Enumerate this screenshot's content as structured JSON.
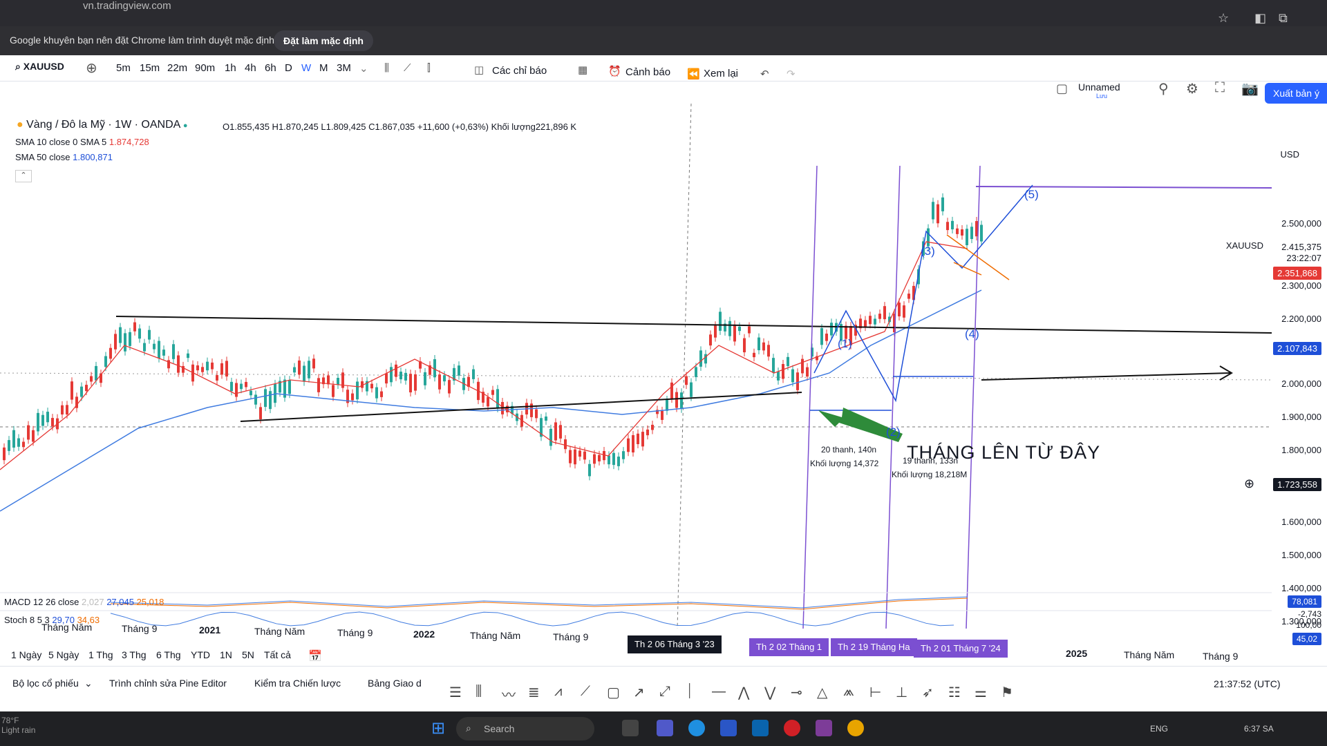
{
  "browser": {
    "url": "vn.tradingview.com",
    "infobar_message": "Google khuyên bạn nên đặt Chrome làm trình duyệt mặc định",
    "infobar_button": "Đặt làm mặc định"
  },
  "toolbar": {
    "symbol": "XAUUSD",
    "intervals": [
      "5m",
      "15m",
      "22m",
      "90m",
      "1h",
      "4h",
      "6h",
      "D",
      "W",
      "M",
      "3M"
    ],
    "active_interval": "W",
    "indicators": "Các chỉ báo",
    "alerts": "Cảnh báo",
    "replay": "Xem lại",
    "layout_name": "Unnamed",
    "layout_saved": "Lưu",
    "export": "Xuất bản ý",
    "currency": "USD"
  },
  "legend": {
    "title": "Vàng / Đô la Mỹ · 1W · OANDA",
    "ohlc": "O1.855,435  H1.870,245  L1.809,425  C1.867,035  +11,600 (+0,63%)  Khối lượng221,896 K",
    "sma1_label": "SMA 10 close 0 SMA 5",
    "sma1_value": "1.874,728",
    "sma2_label": "SMA 50 close",
    "sma2_value": "1.800,871"
  },
  "price_axis": {
    "labels": [
      "2.500,000",
      "2.300,000",
      "2.200,000",
      "2.000,000",
      "1.900,000",
      "1.800,000",
      "1.600,000",
      "1.500,000",
      "1.400,000",
      "1.300,000"
    ],
    "symbol_tag": "XAUUSD",
    "last_price": "2.415,375",
    "countdown": "23:22:07",
    "tag_red": "2.351,868",
    "tag_blue": "2.107,843",
    "crosshair_price": "1.723,558",
    "macd_tag_1": "78,081",
    "macd_tag_2": "-2,743",
    "macd_tag_3": "100,00",
    "stoch_tag": "45,02"
  },
  "annotations": {
    "waves": [
      "(1)",
      "(2)",
      "(3)",
      "(4)",
      "(5)"
    ],
    "box1_line1": "20 thanh, 140n",
    "box1_line2": "Khối lượng 14,372",
    "box2_line1": "19 thanh, 133n",
    "box2_line2": "Khối lượng 18,218M",
    "big_text": "THÁNG LÊN TỪ ĐÂY"
  },
  "indicators": {
    "macd_label": "MACD 12 26 close",
    "macd_v1": "2,027",
    "macd_v2": "27,045",
    "macd_v3": "25,018",
    "stoch_label": "Stoch 8 5 3",
    "stoch_v1": "29,70",
    "stoch_v2": "34,63"
  },
  "time_axis": {
    "labels": [
      "Tháng Năm",
      "Tháng 9",
      "2021",
      "Tháng Năm",
      "Tháng 9",
      "2022",
      "Tháng Năm",
      "Tháng 9",
      "2025",
      "Tháng Năm",
      "Tháng 9"
    ],
    "crosshair_date": "Th 2 06 Tháng 3 '23",
    "range_box_1": "Th 2 02 Tháng 1",
    "range_box_2": "Th 2 19 Tháng Ha",
    "range_box_3": "Th 2 01 Tháng 7 '24"
  },
  "bottom": {
    "ranges": [
      "1 Ngày",
      "5 Ngày",
      "1 Thg",
      "3 Thg",
      "6 Thg",
      "YTD",
      "1N",
      "5N",
      "Tất cả"
    ],
    "tabs": [
      "Bộ lọc cổ phiếu",
      "Trình chỉnh sửa Pine Editor",
      "Kiểm tra Chiến lược",
      "Bảng Giao d"
    ],
    "time_utc": "21:37:52 (UTC)"
  },
  "taskbar": {
    "weather_temp": "78°F",
    "weather_desc": "Light rain",
    "search": "Search",
    "lang": "ENG",
    "clock": "6:37 SA"
  },
  "colors": {
    "accent": "#2962ff",
    "candle_down": "#e53935",
    "candle_up": "#26a69a",
    "sma50": "#3f7be0",
    "sma10": "#e53935",
    "wave_blue": "#1e4fd8",
    "range_purple": "#7b4fd1"
  }
}
